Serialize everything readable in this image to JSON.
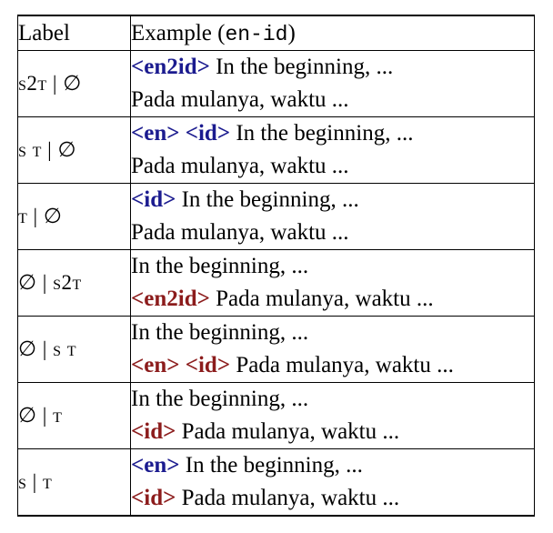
{
  "header": {
    "label": "Label",
    "example_prefix": "Example (",
    "example_lang": "en-id",
    "example_suffix": ")"
  },
  "rows": [
    {
      "label": "s2t | ∅",
      "line1_tag": "<en2id>",
      "line1_text": " In the beginning, ...",
      "line2_tag": "",
      "line2_text": "Pada mulanya, waktu ..."
    },
    {
      "label": "s t | ∅",
      "line1_tag": "<en> <id>",
      "line1_text": " In the beginning, ...",
      "line2_tag": "",
      "line2_text": "Pada mulanya, waktu ..."
    },
    {
      "label": "t | ∅",
      "line1_tag": "<id>",
      "line1_text": " In the beginning, ...",
      "line2_tag": "",
      "line2_text": "Pada mulanya, waktu ..."
    },
    {
      "label": "∅ | s2t",
      "line1_tag": "",
      "line1_text": "In the beginning, ...",
      "line2_tag": "<en2id>",
      "line2_text": " Pada mulanya, waktu ..."
    },
    {
      "label": "∅ | s t",
      "line1_tag": "",
      "line1_text": "In the beginning, ...",
      "line2_tag": "<en> <id>",
      "line2_text": " Pada mulanya, waktu ..."
    },
    {
      "label": "∅ | t",
      "line1_tag": "",
      "line1_text": "In the beginning, ...",
      "line2_tag": "<id>",
      "line2_text": " Pada mulanya, waktu ..."
    },
    {
      "label": "s | t",
      "line1_tag": "<en>",
      "line1_text": " In the beginning, ...",
      "line2_tag": "<id>",
      "line2_text": " Pada mulanya, waktu ..."
    }
  ],
  "colors": {
    "source_tag": "#1b1b8f",
    "target_tag": "#8c1c1c"
  }
}
